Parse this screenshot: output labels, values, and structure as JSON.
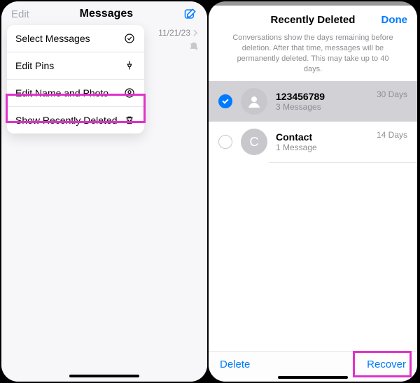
{
  "left": {
    "edit": "Edit",
    "title": "Messages",
    "date": "11/21/23",
    "menu": {
      "select": "Select Messages",
      "pins": "Edit Pins",
      "name_photo": "Edit Name and Photo",
      "recently_deleted": "Show Recently Deleted"
    }
  },
  "right": {
    "title": "Recently Deleted",
    "done": "Done",
    "info": "Conversations show the days remaining before deletion. After that time, messages will be permanently deleted. This may take up to 40 days.",
    "rows": [
      {
        "name": "123456789",
        "sub": "3 Messages",
        "days": "30 Days",
        "initial": "",
        "checked": true
      },
      {
        "name": "Contact",
        "sub": "1 Message",
        "days": "14 Days",
        "initial": "C",
        "checked": false
      }
    ],
    "delete": "Delete",
    "recover": "Recover"
  }
}
